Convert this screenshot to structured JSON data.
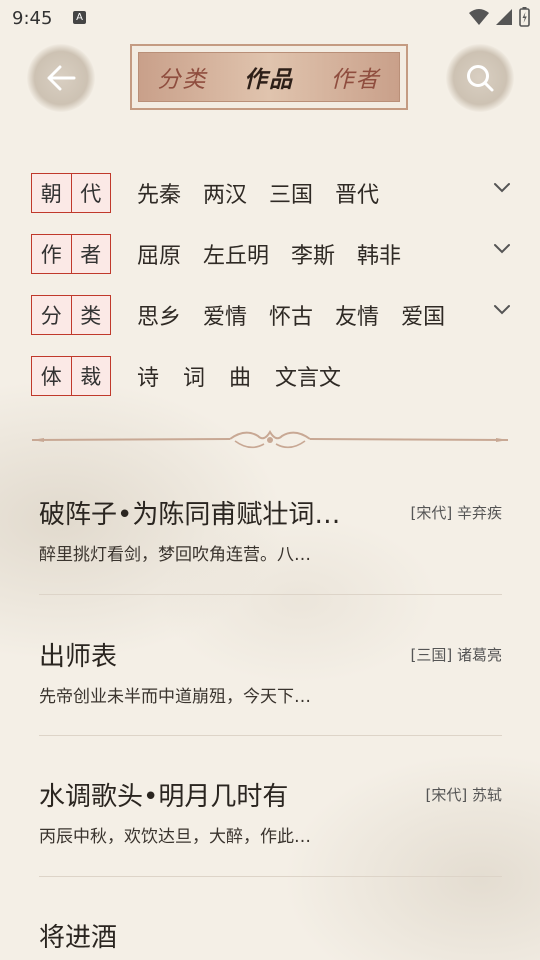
{
  "status": {
    "time": "9:45",
    "a_badge": "A"
  },
  "header": {
    "tabs": [
      {
        "label": "分类",
        "active": false
      },
      {
        "label": "作品",
        "active": true
      },
      {
        "label": "作者",
        "active": false
      }
    ]
  },
  "filters": [
    {
      "label_chars": [
        "朝",
        "代"
      ],
      "options": [
        "先秦",
        "两汉",
        "三国",
        "晋代"
      ],
      "expandable": true
    },
    {
      "label_chars": [
        "作",
        "者"
      ],
      "options": [
        "屈原",
        "左丘明",
        "李斯",
        "韩非"
      ],
      "expandable": true
    },
    {
      "label_chars": [
        "分",
        "类"
      ],
      "options": [
        "思乡",
        "爱情",
        "怀古",
        "友情",
        "爱国"
      ],
      "expandable": true
    },
    {
      "label_chars": [
        "体",
        "裁"
      ],
      "options": [
        "诗",
        "词",
        "曲",
        "文言文"
      ],
      "expandable": false
    }
  ],
  "works": [
    {
      "title": "破阵子•为陈同甫赋壮词…",
      "meta": "[宋代] 辛弃疾",
      "excerpt": "醉里挑灯看剑，梦回吹角连营。八…"
    },
    {
      "title": "出师表",
      "meta": "[三国] 诸葛亮",
      "excerpt": "先帝创业未半而中道崩殂，今天下…"
    },
    {
      "title": "水调歌头•明月几时有",
      "meta": "[宋代] 苏轼",
      "excerpt": "丙辰中秋，欢饮达旦，大醉，作此…"
    },
    {
      "title": "将进酒",
      "meta": "",
      "excerpt": ""
    }
  ],
  "colors": {
    "accent_red": "#c0392b",
    "tab_bg": "#d9b9a3",
    "page_bg": "#f4efe6"
  }
}
